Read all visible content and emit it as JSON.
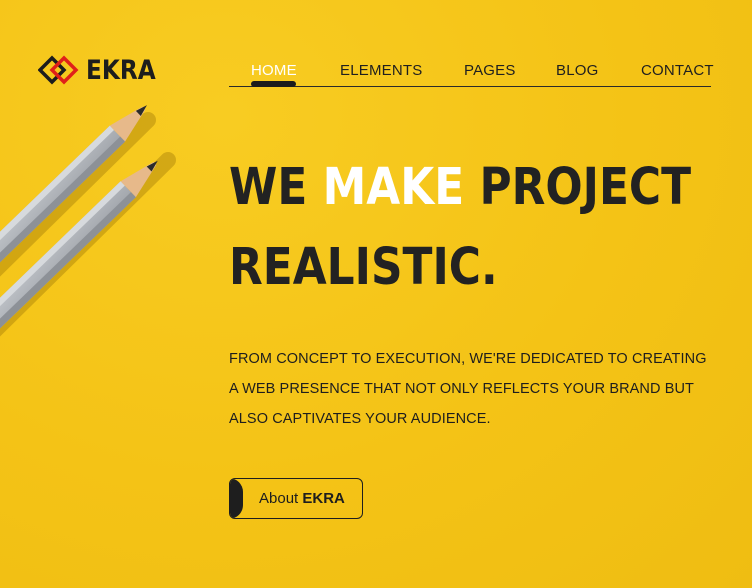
{
  "brand": {
    "name": "EKRA",
    "logo_icon": "interlocking-diamonds-icon",
    "colors": {
      "red": "#e02019",
      "dark": "#1d1d1d"
    }
  },
  "nav": {
    "items": [
      {
        "label": "HOME",
        "active": true
      },
      {
        "label": "ELEMENTS",
        "active": false
      },
      {
        "label": "PAGES",
        "active": false
      },
      {
        "label": "BLOG",
        "active": false
      },
      {
        "label": "CONTACT",
        "active": false
      }
    ]
  },
  "hero": {
    "line1_before": "WE",
    "line1_accent": "MAKE",
    "line1_after": "PROJECT",
    "line2": "REALISTIC."
  },
  "description": {
    "lines": [
      "FROM CONCEPT TO EXECUTION, WE'RE DEDICATED TO CREATING",
      "A WEB PRESENCE THAT NOT ONLY REFLECTS YOUR BRAND BUT",
      "ALSO CAPTIVATES YOUR AUDIENCE."
    ]
  },
  "cta": {
    "label": "About",
    "brand": "EKRA"
  },
  "theme": {
    "background": "#f5c417",
    "text": "#222222",
    "accent": "#ffffff"
  }
}
